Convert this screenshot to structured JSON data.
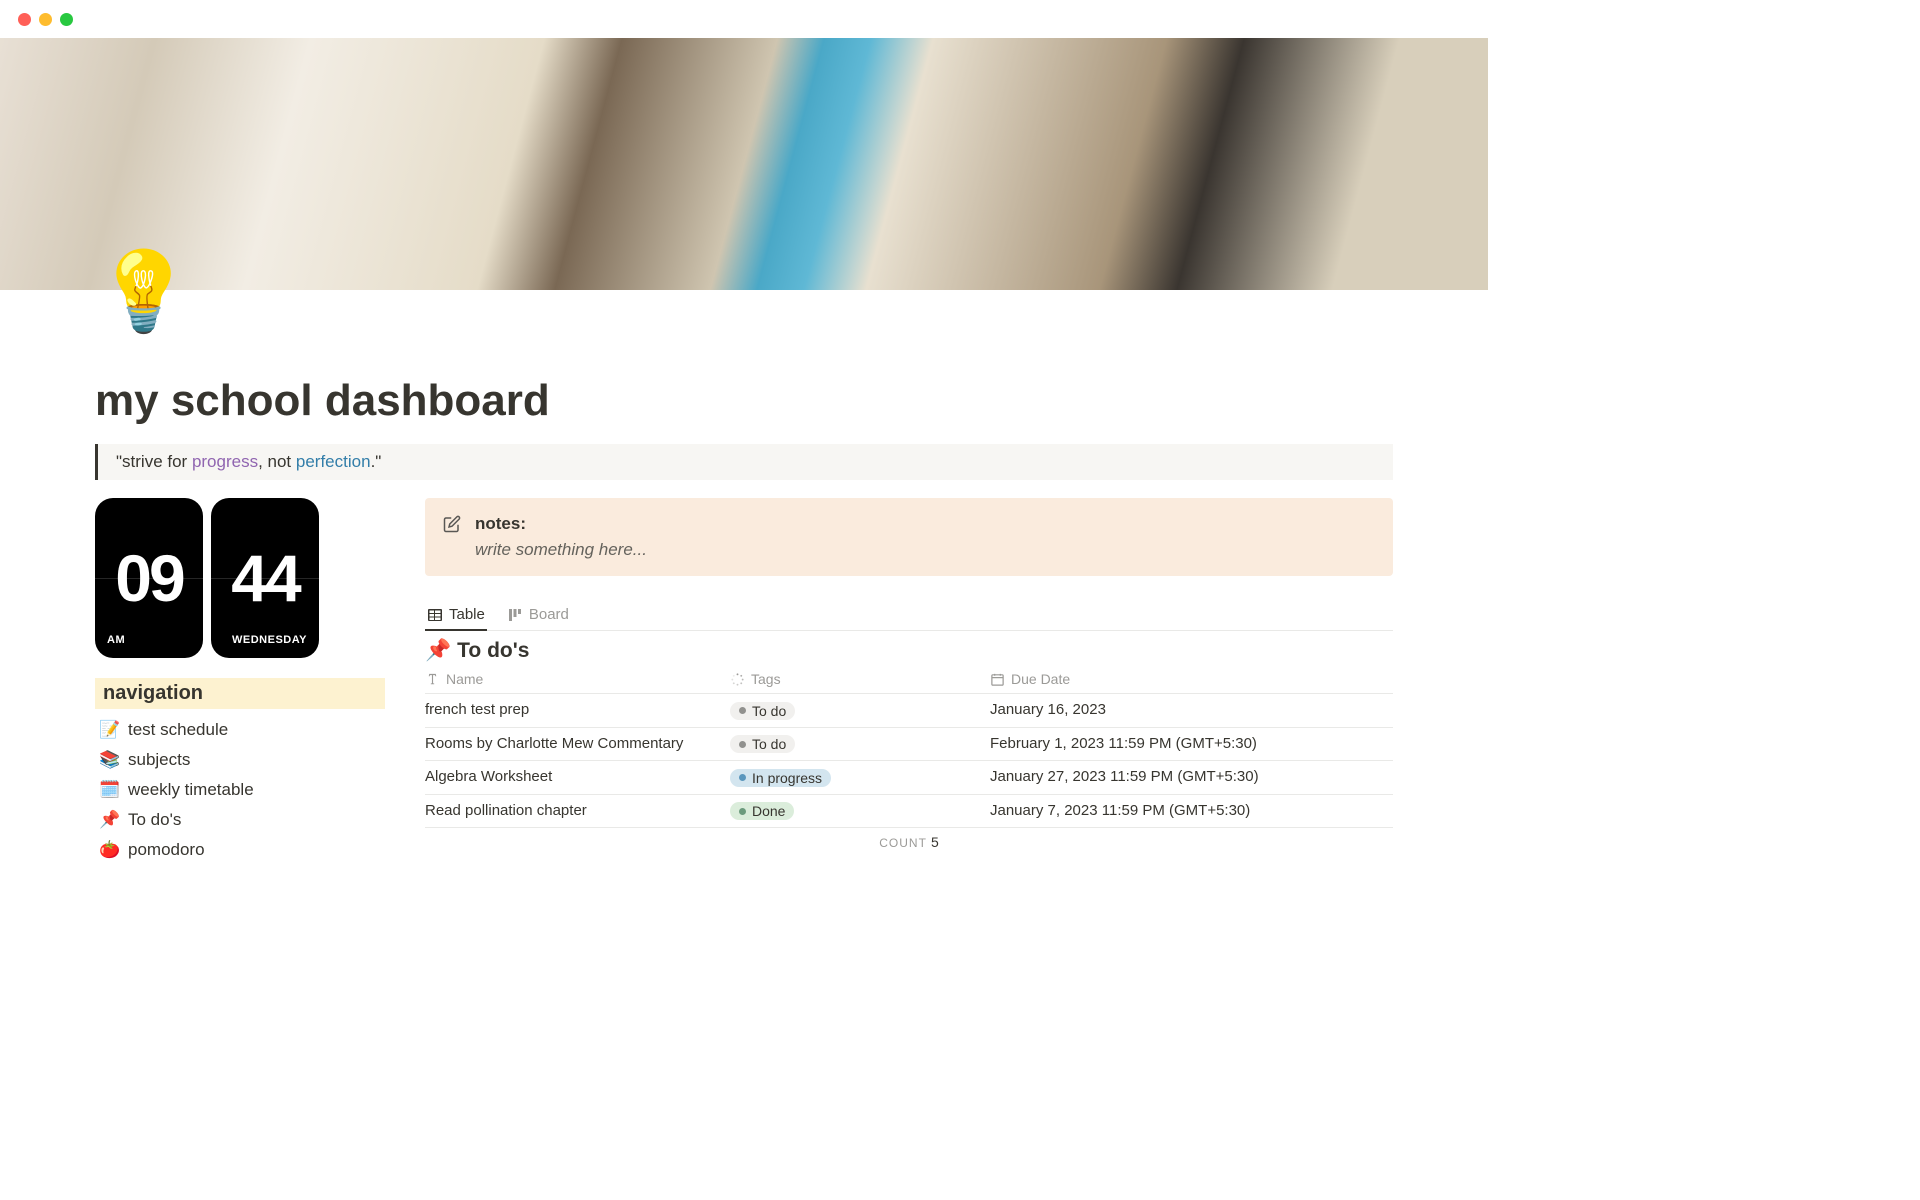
{
  "page": {
    "icon": "💡",
    "title": "my school dashboard"
  },
  "quote": {
    "prefix": "\"strive for ",
    "word1": "progress",
    "mid": ", not ",
    "word2": "perfection",
    "suffix": ".\""
  },
  "clock": {
    "hour": "09",
    "minute": "44",
    "ampm": "AM",
    "day": "WEDNESDAY"
  },
  "nav": {
    "header": "navigation",
    "items": [
      {
        "emoji": "📝",
        "label": "test schedule"
      },
      {
        "emoji": "📚",
        "label": "subjects"
      },
      {
        "emoji": "🗓️",
        "label": "weekly timetable"
      },
      {
        "emoji": "📌",
        "label": "To do's"
      },
      {
        "emoji": "🍅",
        "label": "pomodoro"
      }
    ]
  },
  "notes": {
    "title": "notes:",
    "body": "write something here..."
  },
  "views": {
    "table": "Table",
    "board": "Board"
  },
  "db": {
    "icon": "📌",
    "title": "To do's",
    "headers": {
      "name": "Name",
      "tags": "Tags",
      "date": "Due Date"
    },
    "rows": [
      {
        "name": "french test prep",
        "tag": "todo",
        "tagLabel": "To do",
        "date": "January 16, 2023"
      },
      {
        "name": "Rooms by Charlotte Mew Commentary",
        "tag": "todo",
        "tagLabel": "To do",
        "date": "February 1, 2023 11:59 PM (GMT+5:30)"
      },
      {
        "name": "Algebra Worksheet",
        "tag": "progress",
        "tagLabel": "In progress",
        "date": "January 27, 2023 11:59 PM (GMT+5:30)"
      },
      {
        "name": "Read pollination chapter",
        "tag": "done",
        "tagLabel": "Done",
        "date": "January 7, 2023 11:59 PM (GMT+5:30)"
      }
    ],
    "countLabel": "COUNT",
    "count": "5"
  }
}
